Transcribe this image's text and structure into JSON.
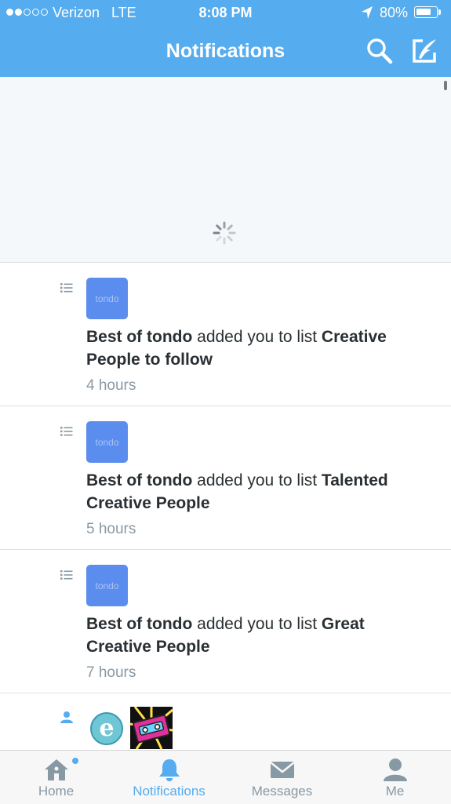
{
  "status_bar": {
    "carrier": "Verizon",
    "network": "LTE",
    "time": "8:08 PM",
    "battery": "80%",
    "battery_level": 0.8,
    "signal_bars_filled": 2,
    "signal_bars_total": 5
  },
  "nav": {
    "title": "Notifications",
    "search_icon": "search-icon",
    "compose_icon": "compose-icon"
  },
  "notifications": [
    {
      "actor": "Best of tondo",
      "action": " added you to list ",
      "list_name": "Creative People to follow",
      "time": "4 hours",
      "avatar_text": "tondo",
      "type_icon": "list-icon"
    },
    {
      "actor": "Best of tondo",
      "action": " added you to list ",
      "list_name": "Talented Creative People",
      "time": "5 hours",
      "avatar_text": "tondo",
      "type_icon": "list-icon"
    },
    {
      "actor": "Best of tondo",
      "action": " added you to list ",
      "list_name": "Great Creative People",
      "time": "7 hours",
      "avatar_text": "tondo",
      "type_icon": "list-icon"
    }
  ],
  "partial_row": {
    "type_icon": "person-icon",
    "avatar_1_letter": "e"
  },
  "tabs": [
    {
      "label": "Home",
      "icon": "home-icon",
      "active": false,
      "has_badge": true
    },
    {
      "label": "Notifications",
      "icon": "bell-icon",
      "active": true,
      "has_badge": false
    },
    {
      "label": "Messages",
      "icon": "envelope-icon",
      "active": false,
      "has_badge": false
    },
    {
      "label": "Me",
      "icon": "person-icon",
      "active": false,
      "has_badge": false
    }
  ],
  "colors": {
    "accent": "#55acee",
    "tondo_avatar": "#5b8def",
    "text_primary": "#292f33",
    "text_secondary": "#8899a6"
  }
}
